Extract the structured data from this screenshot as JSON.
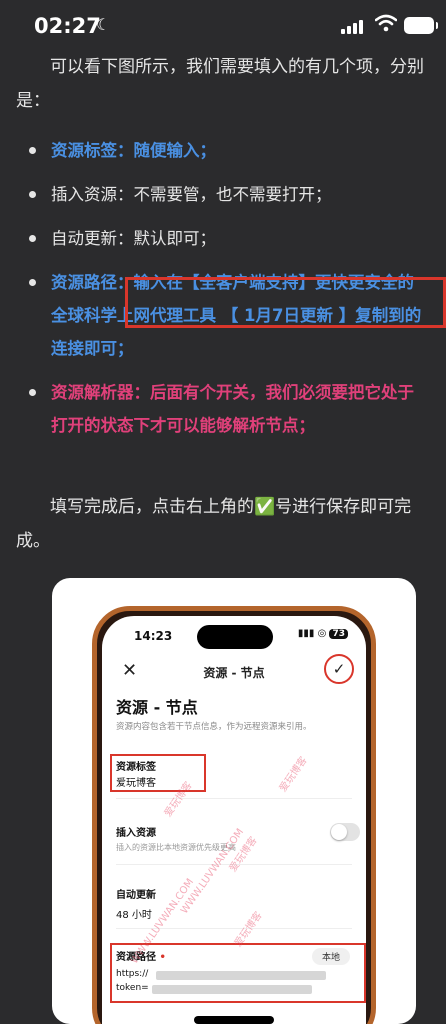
{
  "status_bar": {
    "time": "02:27"
  },
  "article": {
    "intro": "可以看下图所示，我们需要填入的有几个项，分别是：",
    "items": [
      {
        "key": "资源标签：",
        "text": "随便输入；"
      },
      {
        "key": "插入资源：",
        "text": "不需要管，也不需要打开；"
      },
      {
        "key": "自动更新：",
        "text": "默认即可；"
      },
      {
        "key": "资源路径：",
        "text": "输入在【全客户端支持】更快更安全的全球科学上网代理工具 【 1月7日更新 】复制到的连接即可；"
      },
      {
        "key": "资源解析器：",
        "text": "后面有个开关，我们必须要把它处于打开的状态下才可以能够解析节点；"
      }
    ],
    "outro": "填写完成后，点击右上角的✅号进行保存即可完成。"
  },
  "screenshot": {
    "time": "14:23",
    "battery": "73",
    "nav_title": "资源 - 节点",
    "heading": "资源 - 节点",
    "description": "资源内容包含若干节点信息，作为远程资源来引用。",
    "tag_label": "资源标签",
    "tag_value": "爱玩博客",
    "insert_label": "插入资源",
    "insert_desc": "插入的资源比本地资源优先级更高",
    "auto_label": "自动更新",
    "auto_value": "48 小时",
    "path_label": "资源路径",
    "path_required": "•",
    "local_button": "本地",
    "url_prefix": "https://",
    "token_prefix": "token=",
    "watermark_cn": "爱玩博客",
    "watermark_en": "WWW.LUVWAN.COM"
  },
  "colors": {
    "accent_blue": "#4a90e2",
    "accent_pink": "#e0407a",
    "highlight_red": "#d9362b"
  }
}
